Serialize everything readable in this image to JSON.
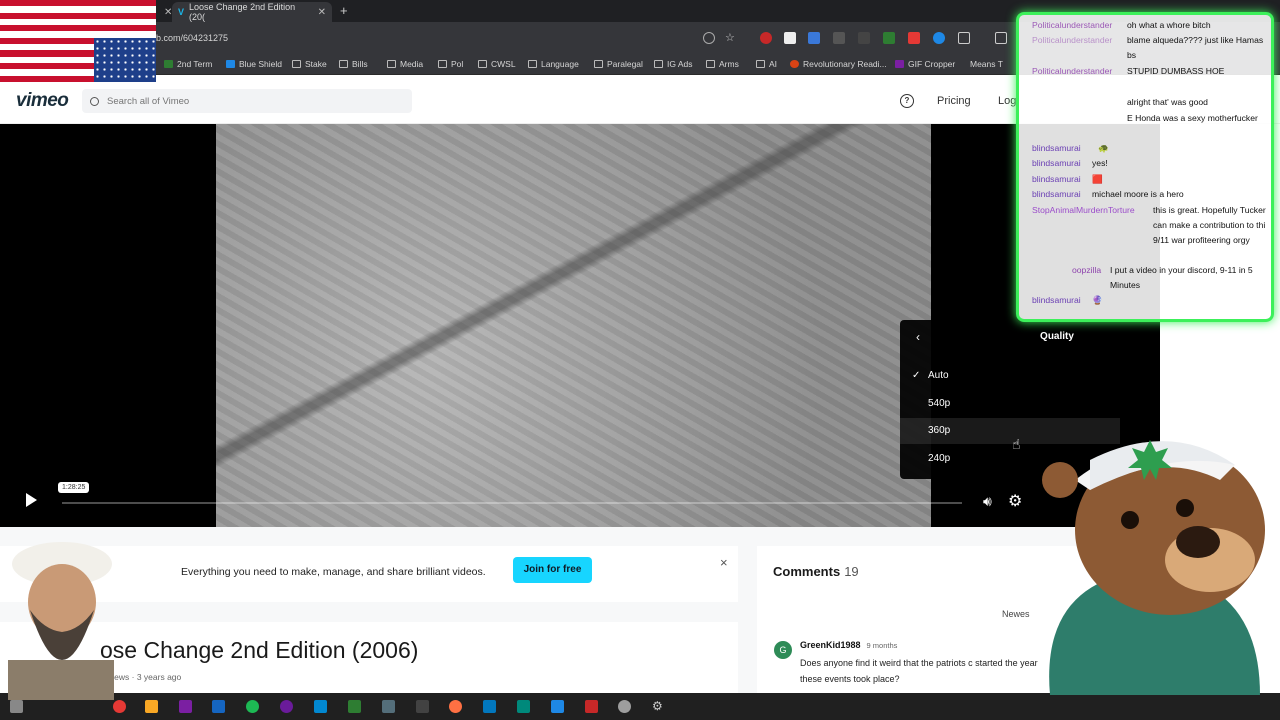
{
  "browser": {
    "tabs": [
      {
        "label": "Loose Change 2nd Edition (20("
      },
      {
        "label": "+"
      }
    ],
    "url": "b.com/604231275",
    "bookmarks": [
      "2nd Term",
      "Blue Shield",
      "Stake",
      "Bills",
      "Media",
      "Pol",
      "CWSL",
      "Language",
      "Paralegal",
      "IG Ads",
      "Arms",
      "AI",
      "Revolutionary Readi...",
      "GIF Cropper",
      "Means T"
    ]
  },
  "vimeo": {
    "logo": "vimeo",
    "search_placeholder": "Search all of Vimeo",
    "help": "?",
    "pricing": "Pricing",
    "login": "Log"
  },
  "player": {
    "timecode": "1:28:25",
    "quality": {
      "back": "‹",
      "title": "Quality",
      "options": [
        "Auto",
        "540p",
        "360p",
        "240p"
      ],
      "selected": "Auto",
      "hovered": "360p"
    }
  },
  "promo": {
    "text": "Everything you need to make, manage, and share brilliant videos.",
    "join_label": "Join for free",
    "close": "×"
  },
  "video": {
    "title": "ose Change 2nd Edition (2006)",
    "meta": "K views · 3 years ago"
  },
  "comments": {
    "heading": "Comments",
    "count": "19",
    "sort": "Newes",
    "items": [
      {
        "avatar": "G",
        "user": "GreenKid1988",
        "time": "9 months",
        "text": "Does anyone find it weird that the patriots c started the year these events took place?"
      }
    ]
  },
  "chat": {
    "messages": [
      {
        "user": "Politicalunderstander",
        "text": "oh what a whore bitch"
      },
      {
        "user": "Politicalunderstander",
        "text": "blame alqueda???? just like Hamas bs"
      },
      {
        "user": "Politicalunderstander",
        "text": "STUPID DUMBASS HOE"
      },
      {
        "user": "",
        "text": "alright that' was good"
      },
      {
        "user": "",
        "text": "E Honda was a sexy motherfucker"
      },
      {
        "user": "blindsamurai",
        "text": "🐢"
      },
      {
        "user": "blindsamurai",
        "text": "yes!"
      },
      {
        "user": "blindsamurai",
        "text": "🟥"
      },
      {
        "user": "blindsamurai",
        "text": "michael moore is a hero"
      },
      {
        "user": "StopAnimalMurdernTorture",
        "text": "this is great. Hopefully Tucker can make a contribution to thi 9/11 war profiteering orgy"
      },
      {
        "user": "oopzilla",
        "text": "I put a video in your discord, 9-11 in 5 Minutes"
      },
      {
        "user": "blindsamurai",
        "text": "🔮"
      }
    ]
  },
  "colors": {
    "vimeo_blue": "#17d5ff",
    "chat_border": "#3cf05a",
    "politicalunderstander": "#9b59b6",
    "blindsamurai": "#6a3fb3",
    "stopanimal": "#9b4dca",
    "oopzilla": "#8e44ad"
  }
}
